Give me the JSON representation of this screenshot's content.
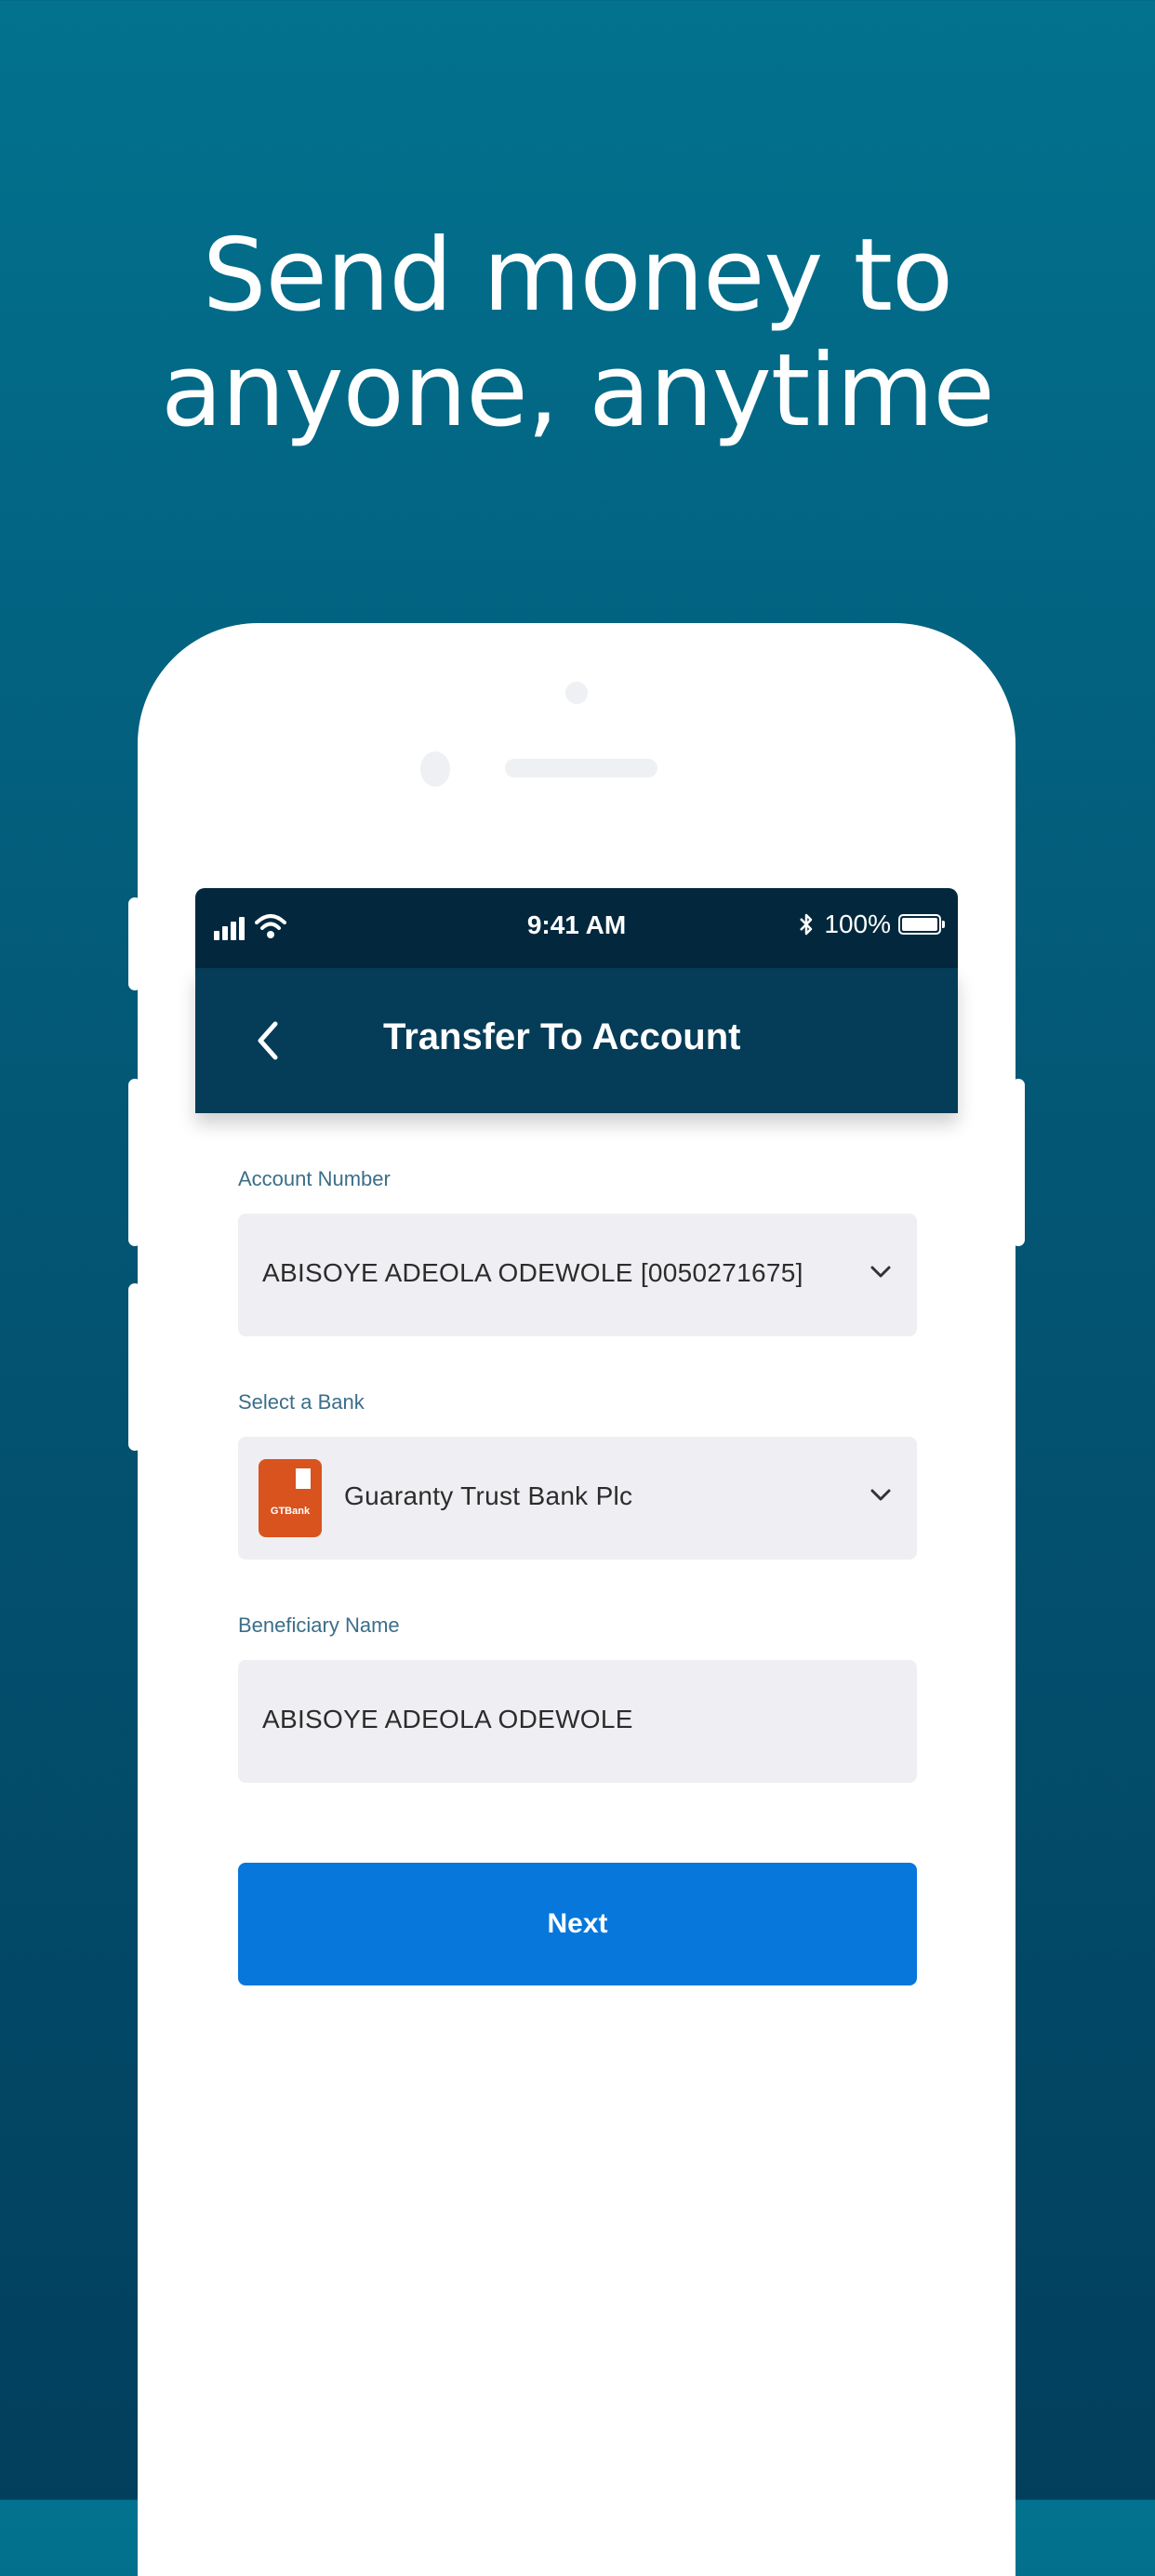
{
  "headline": {
    "line1": "Send money to",
    "line2": "anyone, anytime"
  },
  "status_bar": {
    "time": "9:41 AM",
    "battery": "100%"
  },
  "nav": {
    "title": "Transfer To Account",
    "back_icon": "chevron-left-icon"
  },
  "form": {
    "account": {
      "label": "Account Number",
      "value": "ABISOYE ADEOLA ODEWOLE [0050271675]"
    },
    "bank": {
      "label": "Select a Bank",
      "value": "Guaranty Trust Bank Plc",
      "logo_text": "GTBank",
      "logo_color": "#d9531e"
    },
    "beneficiary": {
      "label": "Beneficiary Name",
      "value": "ABISOYE ADEOLA ODEWOLE"
    }
  },
  "next_button": {
    "label": "Next"
  },
  "colors": {
    "background": "#035775",
    "navbar": "#053c58",
    "accent": "#0777dc"
  }
}
